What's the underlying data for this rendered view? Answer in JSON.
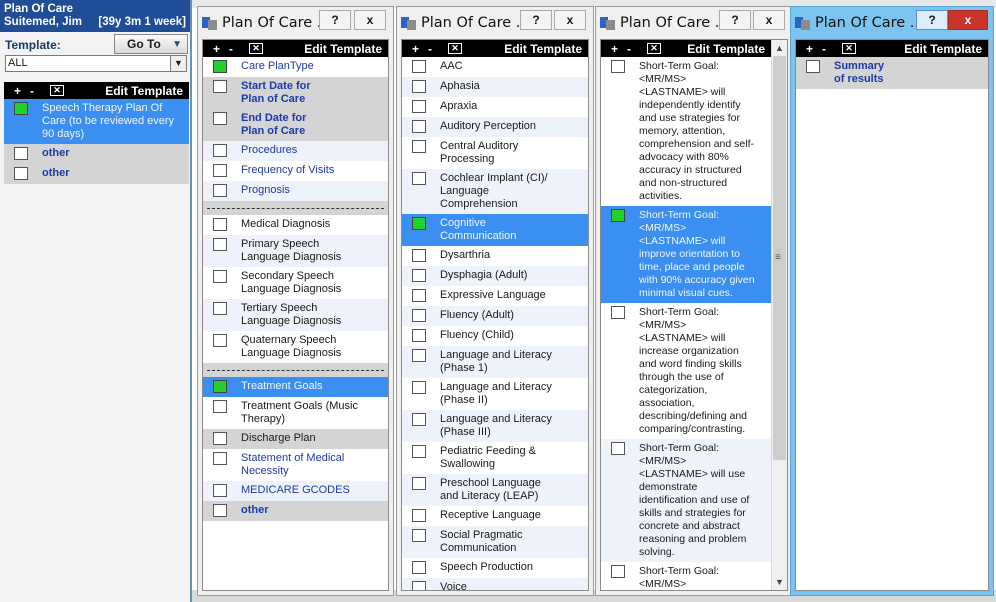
{
  "left_panel": {
    "title": "Plan Of Care",
    "patient_name": "Suitemed, Jim",
    "patient_age": "[39y 3m 1 week]",
    "template_label": "Template:",
    "goto_label": "Go To",
    "template_value": "ALL",
    "edit_bar": {
      "plus": "+",
      "minus": "-",
      "edit_label": "Edit Template"
    },
    "items": [
      {
        "label": "Speech Therapy Plan Of Care (to be reviewed every 90 days)",
        "checked": true
      },
      {
        "label": "other",
        "checked": false
      },
      {
        "label": "other",
        "checked": false
      }
    ]
  },
  "windows": [
    {
      "title": "Plan Of Care ...",
      "help": "?",
      "close": "x",
      "edit_bar": {
        "plus": "+",
        "minus": "-",
        "edit_label": "Edit Template"
      },
      "items": [
        {
          "label": "Care PlanType",
          "checked": true
        },
        {
          "label": "Start Date for Plan of Care",
          "checked": false
        },
        {
          "label": "End Date for Plan of Care",
          "checked": false
        },
        {
          "label": "Procedures",
          "checked": false
        },
        {
          "label": "Frequency of Visits",
          "checked": false
        },
        {
          "label": "Prognosis",
          "checked": false
        },
        {
          "label": "Medical Diagnosis",
          "checked": false
        },
        {
          "label": "Primary Speech Language Diagnosis",
          "checked": false
        },
        {
          "label": "Secondary Speech Language Diagnosis",
          "checked": false
        },
        {
          "label": "Tertiary Speech Language Diagnosis",
          "checked": false
        },
        {
          "label": "Quaternary Speech Language Diagnosis",
          "checked": false
        },
        {
          "label": "Treatment Goals",
          "checked": true
        },
        {
          "label": "Treatment Goals (Music Therapy)",
          "checked": false
        },
        {
          "label": "Discharge Plan",
          "checked": false
        },
        {
          "label": "Statement of Medical Necessity",
          "checked": false
        },
        {
          "label": "MEDICARE GCODES",
          "checked": false
        },
        {
          "label": "other",
          "checked": false
        }
      ]
    },
    {
      "title": "Plan Of Care ...",
      "help": "?",
      "close": "x",
      "edit_bar": {
        "plus": "+",
        "minus": "-",
        "edit_label": "Edit Template"
      },
      "items": [
        {
          "label": "AAC",
          "checked": false
        },
        {
          "label": "Aphasia",
          "checked": false
        },
        {
          "label": "Apraxia",
          "checked": false
        },
        {
          "label": "Auditory Perception",
          "checked": false
        },
        {
          "label": "Central Auditory Processing",
          "checked": false
        },
        {
          "label": "Cochlear Implant (CI)/ Language Comprehension",
          "checked": false
        },
        {
          "label": "Cognitive Communication",
          "checked": true
        },
        {
          "label": "Dysarthria",
          "checked": false
        },
        {
          "label": "Dysphagia (Adult)",
          "checked": false
        },
        {
          "label": "Expressive Language",
          "checked": false
        },
        {
          "label": "Fluency (Adult)",
          "checked": false
        },
        {
          "label": "Fluency (Child)",
          "checked": false
        },
        {
          "label": "Language and Literacy (Phase 1)",
          "checked": false
        },
        {
          "label": "Language and Literacy (Phase II)",
          "checked": false
        },
        {
          "label": "Language and Literacy (Phase III)",
          "checked": false
        },
        {
          "label": "Pediatric Feeding & Swallowing",
          "checked": false
        },
        {
          "label": "Preschool Language and Literacy (LEAP)",
          "checked": false
        },
        {
          "label": "Receptive Language",
          "checked": false
        },
        {
          "label": "Social Pragmatic Communication",
          "checked": false
        },
        {
          "label": "Speech Production",
          "checked": false
        },
        {
          "label": "Voice",
          "checked": false
        }
      ]
    },
    {
      "title": "Plan Of Care ...",
      "help": "?",
      "close": "x",
      "edit_bar": {
        "plus": "+",
        "minus": "-",
        "edit_label": "Edit Template"
      },
      "items": [
        {
          "label": "Short-Term Goal: <MR/MS> <LASTNAME> will independently identify and use strategies for memory, attention, comprehension and self-advocacy with 80% accuracy in structured and non-structured activities.",
          "checked": false
        },
        {
          "label": "Short-Term Goal: <MR/MS> <LASTNAME> will improve orientation to time, place and people with 90% accuracy given minimal visual cues.",
          "checked": true
        },
        {
          "label": "Short-Term Goal: <MR/MS> <LASTNAME> will increase organization and word finding skills through the use of categorization, association, describing/defining and comparing/contrasting.",
          "checked": false
        },
        {
          "label": "Short-Term Goal: <MR/MS> <LASTNAME> will use demonstrate identification and use of skills and strategies for concrete and abstract reasoning and problem solving.",
          "checked": false
        },
        {
          "label": "Short-Term Goal: <MR/MS>",
          "checked": false
        }
      ],
      "scroll_up": "▲",
      "scroll_down": "▼",
      "scroll_grip": "≡"
    },
    {
      "title": "Plan Of Care ...",
      "help": "?",
      "close": "x",
      "edit_bar": {
        "plus": "+",
        "minus": "-",
        "edit_label": "Edit Template"
      },
      "items": [
        {
          "label": "Summary of results",
          "checked": false
        }
      ]
    }
  ]
}
